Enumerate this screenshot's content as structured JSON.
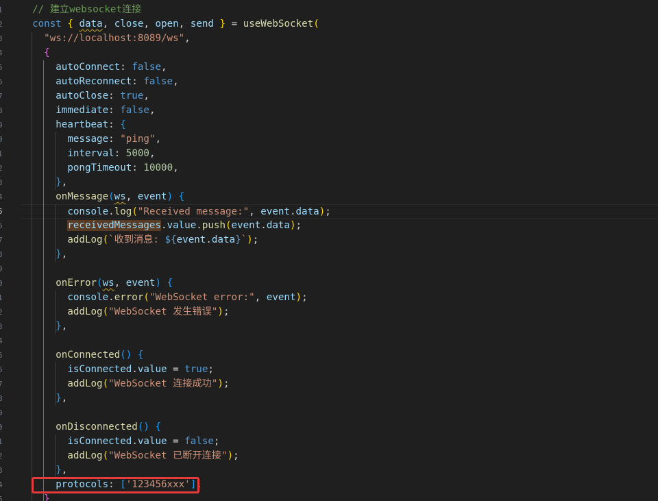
{
  "editor": {
    "active_line": 15,
    "lines": [
      {
        "n": "1",
        "toks": [
          [
            "  ",
            ""
          ],
          [
            "// 建立websocket连接",
            "c-comment"
          ]
        ]
      },
      {
        "n": "2",
        "toks": [
          [
            "  ",
            ""
          ],
          [
            "const",
            "c-kw"
          ],
          [
            " ",
            ""
          ],
          [
            "{",
            "c-b1"
          ],
          [
            " ",
            ""
          ],
          [
            "data",
            "c-var c-squiggle"
          ],
          [
            ", ",
            "c-punct"
          ],
          [
            "close",
            "c-var"
          ],
          [
            ", ",
            "c-punct"
          ],
          [
            "open",
            "c-var"
          ],
          [
            ", ",
            "c-punct"
          ],
          [
            "send",
            "c-var"
          ],
          [
            " ",
            ""
          ],
          [
            "}",
            "c-b1"
          ],
          [
            " = ",
            "c-punct"
          ],
          [
            "useWebSocket",
            "c-func"
          ],
          [
            "(",
            "c-b1"
          ]
        ]
      },
      {
        "n": "3",
        "toks": [
          [
            "    ",
            ""
          ],
          [
            "\"ws://localhost:8089/ws\"",
            "c-str"
          ],
          [
            ",",
            "c-punct"
          ]
        ]
      },
      {
        "n": "4",
        "toks": [
          [
            "    ",
            ""
          ],
          [
            "{",
            "c-b2"
          ]
        ]
      },
      {
        "n": "5",
        "toks": [
          [
            "      ",
            ""
          ],
          [
            "autoConnect",
            "c-var"
          ],
          [
            ": ",
            "c-punct"
          ],
          [
            "false",
            "c-kw"
          ],
          [
            ",",
            "c-punct"
          ]
        ]
      },
      {
        "n": "6",
        "toks": [
          [
            "      ",
            ""
          ],
          [
            "autoReconnect",
            "c-var"
          ],
          [
            ": ",
            "c-punct"
          ],
          [
            "false",
            "c-kw"
          ],
          [
            ",",
            "c-punct"
          ]
        ]
      },
      {
        "n": "7",
        "toks": [
          [
            "      ",
            ""
          ],
          [
            "autoClose",
            "c-var"
          ],
          [
            ": ",
            "c-punct"
          ],
          [
            "true",
            "c-kw"
          ],
          [
            ",",
            "c-punct"
          ]
        ]
      },
      {
        "n": "8",
        "toks": [
          [
            "      ",
            ""
          ],
          [
            "immediate",
            "c-var"
          ],
          [
            ": ",
            "c-punct"
          ],
          [
            "false",
            "c-kw"
          ],
          [
            ",",
            "c-punct"
          ]
        ]
      },
      {
        "n": "9",
        "toks": [
          [
            "      ",
            ""
          ],
          [
            "heartbeat",
            "c-var"
          ],
          [
            ": ",
            "c-punct"
          ],
          [
            "{",
            "c-b3"
          ]
        ]
      },
      {
        "n": "0",
        "toks": [
          [
            "        ",
            ""
          ],
          [
            "message",
            "c-var"
          ],
          [
            ": ",
            "c-punct"
          ],
          [
            "\"ping\"",
            "c-str"
          ],
          [
            ",",
            "c-punct"
          ]
        ]
      },
      {
        "n": "1",
        "toks": [
          [
            "        ",
            ""
          ],
          [
            "interval",
            "c-var"
          ],
          [
            ": ",
            "c-punct"
          ],
          [
            "5000",
            "c-num"
          ],
          [
            ",",
            "c-punct"
          ]
        ]
      },
      {
        "n": "2",
        "toks": [
          [
            "        ",
            ""
          ],
          [
            "pongTimeout",
            "c-var"
          ],
          [
            ": ",
            "c-punct"
          ],
          [
            "10000",
            "c-num"
          ],
          [
            ",",
            "c-punct"
          ]
        ]
      },
      {
        "n": "3",
        "toks": [
          [
            "      ",
            ""
          ],
          [
            "}",
            "c-b3"
          ],
          [
            ",",
            "c-punct"
          ]
        ]
      },
      {
        "n": "4",
        "toks": [
          [
            "      ",
            ""
          ],
          [
            "onMessage",
            "c-func"
          ],
          [
            "(",
            "c-b3"
          ],
          [
            "ws",
            "c-var c-squiggle"
          ],
          [
            ", ",
            "c-punct"
          ],
          [
            "event",
            "c-var"
          ],
          [
            ")",
            "c-b3"
          ],
          [
            " ",
            ""
          ],
          [
            "{",
            "c-b3"
          ]
        ]
      },
      {
        "n": "5",
        "toks": [
          [
            "        ",
            ""
          ],
          [
            "console",
            "c-var"
          ],
          [
            ".",
            "c-punct"
          ],
          [
            "log",
            "c-func"
          ],
          [
            "(",
            "c-b1"
          ],
          [
            "\"Received message:\"",
            "c-str"
          ],
          [
            ", ",
            "c-punct"
          ],
          [
            "event",
            "c-var"
          ],
          [
            ".",
            "c-punct"
          ],
          [
            "data",
            "c-var"
          ],
          [
            ")",
            "c-b1"
          ],
          [
            ";",
            "c-punct"
          ]
        ]
      },
      {
        "n": "6",
        "toks": [
          [
            "        ",
            ""
          ],
          [
            "receivedMessages",
            "c-var c-highlight"
          ],
          [
            ".",
            "c-punct"
          ],
          [
            "value",
            "c-var"
          ],
          [
            ".",
            "c-punct"
          ],
          [
            "push",
            "c-func"
          ],
          [
            "(",
            "c-b1"
          ],
          [
            "event",
            "c-var"
          ],
          [
            ".",
            "c-punct"
          ],
          [
            "data",
            "c-var"
          ],
          [
            ")",
            "c-b1"
          ],
          [
            ";",
            "c-punct"
          ]
        ]
      },
      {
        "n": "7",
        "toks": [
          [
            "        ",
            ""
          ],
          [
            "addLog",
            "c-func"
          ],
          [
            "(",
            "c-b1"
          ],
          [
            "`收到消息: ",
            "c-str"
          ],
          [
            "${",
            "c-kw"
          ],
          [
            "event",
            "c-var"
          ],
          [
            ".",
            "c-punct"
          ],
          [
            "data",
            "c-var"
          ],
          [
            "}",
            "c-kw"
          ],
          [
            "`",
            "c-str"
          ],
          [
            ")",
            "c-b1"
          ],
          [
            ";",
            "c-punct"
          ]
        ]
      },
      {
        "n": "8",
        "toks": [
          [
            "      ",
            ""
          ],
          [
            "}",
            "c-b3"
          ],
          [
            ",",
            "c-punct"
          ]
        ]
      },
      {
        "n": "9",
        "toks": [
          [
            "",
            ""
          ]
        ]
      },
      {
        "n": "0",
        "toks": [
          [
            "      ",
            ""
          ],
          [
            "onError",
            "c-func"
          ],
          [
            "(",
            "c-b3"
          ],
          [
            "ws",
            "c-var c-squiggle"
          ],
          [
            ", ",
            "c-punct"
          ],
          [
            "event",
            "c-var"
          ],
          [
            ")",
            "c-b3"
          ],
          [
            " ",
            ""
          ],
          [
            "{",
            "c-b3"
          ]
        ]
      },
      {
        "n": "1",
        "toks": [
          [
            "        ",
            ""
          ],
          [
            "console",
            "c-var"
          ],
          [
            ".",
            "c-punct"
          ],
          [
            "error",
            "c-func"
          ],
          [
            "(",
            "c-b1"
          ],
          [
            "\"WebSocket error:\"",
            "c-str"
          ],
          [
            ", ",
            "c-punct"
          ],
          [
            "event",
            "c-var"
          ],
          [
            ")",
            "c-b1"
          ],
          [
            ";",
            "c-punct"
          ]
        ]
      },
      {
        "n": "2",
        "toks": [
          [
            "        ",
            ""
          ],
          [
            "addLog",
            "c-func"
          ],
          [
            "(",
            "c-b1"
          ],
          [
            "\"WebSocket 发生错误\"",
            "c-str"
          ],
          [
            ")",
            "c-b1"
          ],
          [
            ";",
            "c-punct"
          ]
        ]
      },
      {
        "n": "3",
        "toks": [
          [
            "      ",
            ""
          ],
          [
            "}",
            "c-b3"
          ],
          [
            ",",
            "c-punct"
          ]
        ]
      },
      {
        "n": "4",
        "toks": [
          [
            "",
            ""
          ]
        ]
      },
      {
        "n": "5",
        "toks": [
          [
            "      ",
            ""
          ],
          [
            "onConnected",
            "c-func"
          ],
          [
            "(",
            "c-b3"
          ],
          [
            ")",
            "c-b3"
          ],
          [
            " ",
            ""
          ],
          [
            "{",
            "c-b3"
          ]
        ]
      },
      {
        "n": "6",
        "toks": [
          [
            "        ",
            ""
          ],
          [
            "isConnected",
            "c-var"
          ],
          [
            ".",
            "c-punct"
          ],
          [
            "value",
            "c-var"
          ],
          [
            " = ",
            "c-punct"
          ],
          [
            "true",
            "c-kw"
          ],
          [
            ";",
            "c-punct"
          ]
        ]
      },
      {
        "n": "7",
        "toks": [
          [
            "        ",
            ""
          ],
          [
            "addLog",
            "c-func"
          ],
          [
            "(",
            "c-b1"
          ],
          [
            "\"WebSocket 连接成功\"",
            "c-str"
          ],
          [
            ")",
            "c-b1"
          ],
          [
            ";",
            "c-punct"
          ]
        ]
      },
      {
        "n": "8",
        "toks": [
          [
            "      ",
            ""
          ],
          [
            "}",
            "c-b3"
          ],
          [
            ",",
            "c-punct"
          ]
        ]
      },
      {
        "n": "9",
        "toks": [
          [
            "",
            ""
          ]
        ]
      },
      {
        "n": "0",
        "toks": [
          [
            "      ",
            ""
          ],
          [
            "onDisconnected",
            "c-func"
          ],
          [
            "(",
            "c-b3"
          ],
          [
            ")",
            "c-b3"
          ],
          [
            " ",
            ""
          ],
          [
            "{",
            "c-b3"
          ]
        ]
      },
      {
        "n": "1",
        "toks": [
          [
            "        ",
            ""
          ],
          [
            "isConnected",
            "c-var"
          ],
          [
            ".",
            "c-punct"
          ],
          [
            "value",
            "c-var"
          ],
          [
            " = ",
            "c-punct"
          ],
          [
            "false",
            "c-kw"
          ],
          [
            ";",
            "c-punct"
          ]
        ]
      },
      {
        "n": "2",
        "toks": [
          [
            "        ",
            ""
          ],
          [
            "addLog",
            "c-func"
          ],
          [
            "(",
            "c-b1"
          ],
          [
            "\"WebSocket 已断开连接\"",
            "c-str"
          ],
          [
            ")",
            "c-b1"
          ],
          [
            ";",
            "c-punct"
          ]
        ]
      },
      {
        "n": "3",
        "toks": [
          [
            "      ",
            ""
          ],
          [
            "}",
            "c-b3"
          ],
          [
            ",",
            "c-punct"
          ]
        ]
      },
      {
        "n": "4",
        "toks": [
          [
            "      ",
            ""
          ],
          [
            "protocols",
            "c-var"
          ],
          [
            ": ",
            "c-punct"
          ],
          [
            "[",
            "c-b3"
          ],
          [
            "'123456xxx'",
            "c-str"
          ],
          [
            "]",
            "c-b3"
          ],
          [
            ",",
            "c-punct"
          ]
        ]
      },
      {
        "n": "5",
        "toks": [
          [
            "    ",
            ""
          ],
          [
            "}",
            "c-b2"
          ]
        ]
      }
    ]
  },
  "annotation": {
    "box_color": "#e53b3b",
    "target": "protocols line"
  },
  "colors": {
    "background": "#1f1f1f",
    "keyword": "#569cd6",
    "variable": "#9cdcfe",
    "function": "#dcdcaa",
    "string": "#ce9178",
    "number": "#b5cea8",
    "comment": "#6a9955"
  }
}
